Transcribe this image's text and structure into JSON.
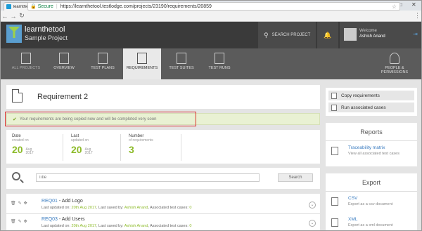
{
  "browser": {
    "tab_title": "learnthetool: Sample Pro",
    "secure_label": "Secure",
    "url": "https://learnthetool.testlodge.com/projects/23190/requirements/20859"
  },
  "header": {
    "brand": "learnthetool",
    "project": "Sample Project",
    "search_label": "SEARCH PROJECT",
    "welcome": "Welcome",
    "username": "Ashish Anand"
  },
  "nav": {
    "items": [
      {
        "label": "ALL PROJECTS"
      },
      {
        "label": "OVERVIEW"
      },
      {
        "label": "TEST PLANS"
      },
      {
        "label": "REQUIREMENTS"
      },
      {
        "label": "TEST SUITES"
      },
      {
        "label": "TEST RUNS"
      },
      {
        "label": "PEOPLE &"
      },
      {
        "label": "PERMISSIONS"
      }
    ]
  },
  "requirement": {
    "title": "Requirement 2",
    "notice": "Your requirements are being copied now and will be completed very soon"
  },
  "stats": {
    "date_label": "Date",
    "date_sub": "created on",
    "date_day": "20",
    "date_month": "Aug",
    "date_year": "2017",
    "last_label": "Last",
    "last_sub": "updated on",
    "last_day": "20",
    "last_month": "Aug",
    "last_year": "2017",
    "number_label": "Number",
    "number_sub": "of requirements",
    "number_value": "3"
  },
  "search": {
    "placeholder": "Title",
    "button": "Search"
  },
  "requirements_list": [
    {
      "id": "REQ01",
      "title": " - Add Logo",
      "updated_prefix": "Last updated on: ",
      "updated": "20th Aug 2017",
      "saved_prefix": ", Last saved by: ",
      "saved_by": "Ashish Anand",
      "cases_prefix": ", Associated test cases: ",
      "cases": "0"
    },
    {
      "id": "REQ03",
      "title": " - Add Users",
      "updated_prefix": "Last updated on: ",
      "updated": "20th Aug 2017",
      "saved_prefix": ", Last saved by: ",
      "saved_by": "Ashish Anand",
      "cases_prefix": ", Associated test cases: ",
      "cases": "0"
    }
  ],
  "sidebar": {
    "copy_btn": "Copy requirements",
    "run_btn": "Run associated cases",
    "reports_head": "Reports",
    "traceability_title": "Traceability matrix",
    "traceability_desc": "View all associated test cases",
    "export_head": "Export",
    "csv_title": "CSV",
    "csv_desc": "Export as a csv document",
    "xml_title": "XML",
    "xml_desc": "Export as a xml document"
  }
}
